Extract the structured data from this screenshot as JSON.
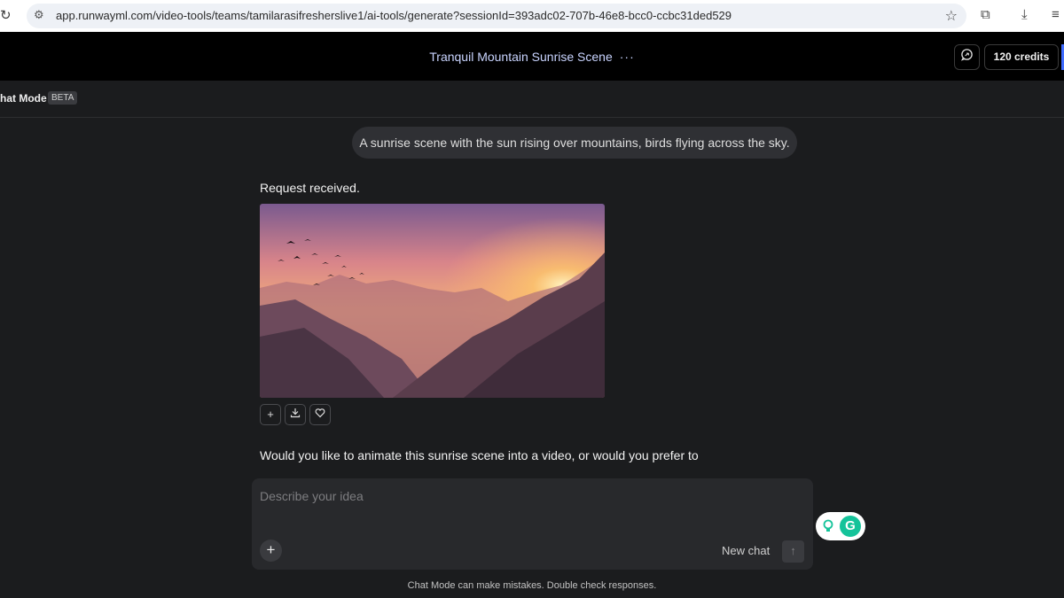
{
  "browser": {
    "url": "app.runwayml.com/video-tools/teams/tamilarasifresherslive1/ai-tools/generate?sessionId=393adc02-707b-46e8-bcc0-ccbc31ded529",
    "icons": [
      "reload-icon",
      "site-info-icon",
      "star-icon",
      "extensions-icon",
      "download-icon",
      "tab-search-icon"
    ]
  },
  "header": {
    "title": "Tranquil Mountain Sunrise Scene",
    "more": "···",
    "credits": "120 credits"
  },
  "mode": {
    "label": "hat Mode",
    "badge": "BETA"
  },
  "conversation": {
    "user_message": "A sunrise scene with the sun rising over mountains, birds flying across the sky.",
    "assistant_ack": "Request received.",
    "assistant_followup": "Would you like to animate this sunrise scene into a video, or would you prefer to"
  },
  "composer": {
    "placeholder": "Describe your idea",
    "new_chat": "New chat"
  },
  "footer": {
    "disclaimer": "Chat Mode can make mistakes. Double check responses."
  },
  "colors": {
    "background": "#1b1c1e",
    "header_bg": "#000000",
    "accent": "#3f6bff",
    "grammarly": "#15c39a"
  }
}
